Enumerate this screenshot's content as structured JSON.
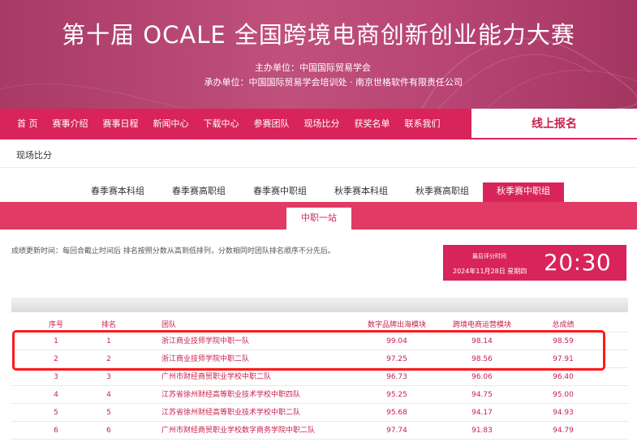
{
  "banner": {
    "title": "第十届 OCALE 全国跨境电商创新创业能力大赛",
    "host": "主办单位：中国国际贸易学会",
    "organizer": "承办单位：中国国际贸易学会培训处 · 南京世格软件有限责任公司"
  },
  "nav": {
    "items": [
      "首 页",
      "赛事介绍",
      "赛事日程",
      "新闻中心",
      "下载中心",
      "参赛团队",
      "现场比分",
      "获奖名单",
      "联系我们"
    ],
    "signup": "线上报名"
  },
  "page_label": "现场比分",
  "tabs": [
    "春季赛本科组",
    "春季赛高职组",
    "春季赛中职组",
    "秋季赛本科组",
    "秋季赛高职组",
    "秋季赛中职组"
  ],
  "active_tab": "秋季赛中职组",
  "subtab": "中职一站",
  "update_note": "成绩更新时间：每回合截止时间后 排名按照分数从高到低排列，分数相同时团队排名顺序不分先后。",
  "timebox": {
    "label": "最后评分时间",
    "date": "2024年11月28日 星期四",
    "time": "20:30"
  },
  "colors": {
    "primary": "#d8245a",
    "highlight_box": "#ff1a1a"
  },
  "table": {
    "headers": [
      "序号",
      "排名",
      "团队",
      "数字品牌出海模块",
      "跨境电商运营模块",
      "总成绩"
    ],
    "rows": [
      {
        "seq": "1",
        "rank": "1",
        "team": "浙江商业技师学院中职一队",
        "s1": "99.04",
        "s2": "98.14",
        "total": "98.59"
      },
      {
        "seq": "2",
        "rank": "2",
        "team": "浙江商业技师学院中职二队",
        "s1": "97.25",
        "s2": "98.56",
        "total": "97.91"
      },
      {
        "seq": "3",
        "rank": "3",
        "team": "广州市财经商贸职业学校中职二队",
        "s1": "96.73",
        "s2": "96.06",
        "total": "96.40"
      },
      {
        "seq": "4",
        "rank": "4",
        "team": "江苏省徐州财经高等职业技术学校中职四队",
        "s1": "95.25",
        "s2": "94.75",
        "total": "95.00"
      },
      {
        "seq": "5",
        "rank": "5",
        "team": "江苏省徐州财经高等职业技术学校中职二队",
        "s1": "95.68",
        "s2": "94.17",
        "total": "94.93"
      },
      {
        "seq": "6",
        "rank": "6",
        "team": "广州市财经商贸职业学校数字商务学院中职二队",
        "s1": "97.74",
        "s2": "91.83",
        "total": "94.79"
      }
    ]
  }
}
